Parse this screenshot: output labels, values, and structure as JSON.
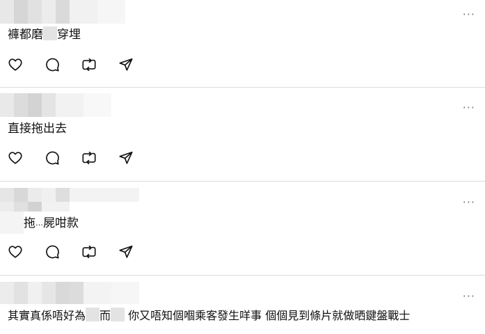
{
  "comments": [
    {
      "text_parts": [
        "褲都磨",
        "穿埋"
      ],
      "has_mask": true
    },
    {
      "text_parts": [
        "直接拖出去"
      ],
      "has_mask": false
    },
    {
      "text_parts": [
        "拖",
        "屍咁款"
      ],
      "has_mask": false,
      "artifact_glyph": "…"
    },
    {
      "text_parts": [
        "其實真係唔好為",
        "而",
        "你又唔知個嗰乘客發生咩事 個個見到條片就做晒鍵盤戰士"
      ],
      "has_mask": true
    }
  ],
  "icons": {
    "more": "more-icon",
    "like": "heart-icon",
    "reply": "comment-icon",
    "repost": "repost-icon",
    "share": "send-icon"
  },
  "more_label": "···",
  "colors": {
    "divider": "#dbdbdb",
    "text": "#101010",
    "muted": "#7a7a7a",
    "mask": "#e3e3e3"
  }
}
